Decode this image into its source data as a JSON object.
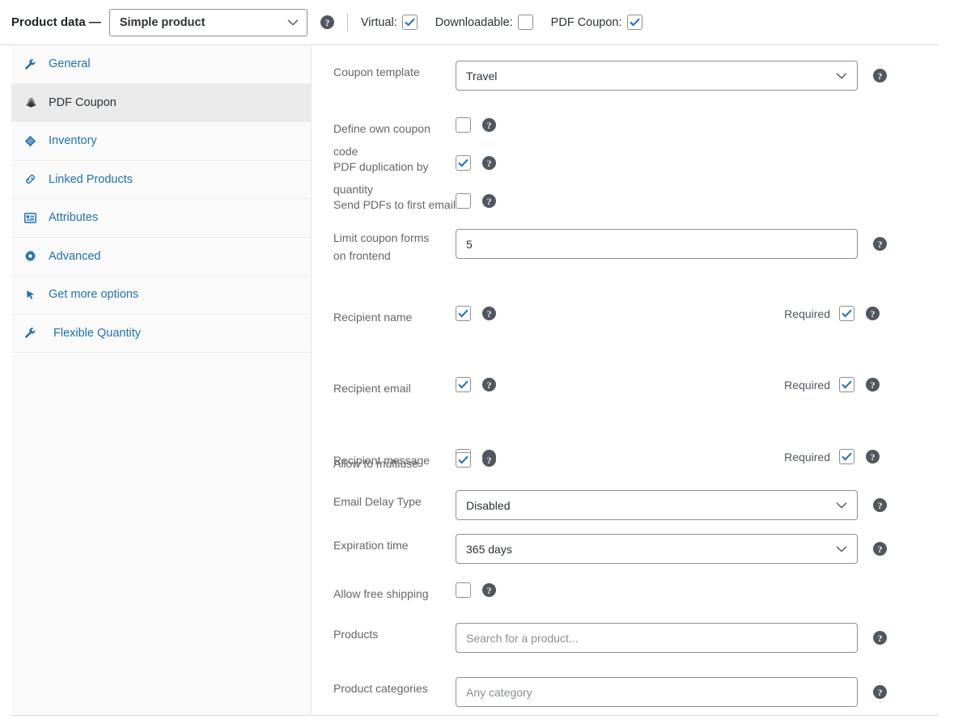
{
  "header": {
    "title": "Product data —",
    "product_type": "Simple product",
    "help_icon": "help-icon",
    "toggles": [
      {
        "label": "Virtual:",
        "checked": true,
        "name": "virtual"
      },
      {
        "label": "Downloadable:",
        "checked": false,
        "name": "downloadable"
      },
      {
        "label": "PDF Coupon:",
        "checked": true,
        "name": "pdf-coupon"
      }
    ]
  },
  "sidebar": {
    "items": [
      {
        "label": "General",
        "icon": "wrench-icon",
        "active": false
      },
      {
        "label": "PDF Coupon",
        "icon": "coupon-stack-icon",
        "active": true
      },
      {
        "label": "Inventory",
        "icon": "diamond-icon",
        "active": false
      },
      {
        "label": "Linked Products",
        "icon": "link-icon",
        "active": false
      },
      {
        "label": "Attributes",
        "icon": "list-card-icon",
        "active": false
      },
      {
        "label": "Advanced",
        "icon": "gear-icon",
        "active": false
      },
      {
        "label": "Get more options",
        "icon": "cursor-click-icon",
        "active": false
      },
      {
        "label": "Flexible Quantity",
        "icon": "wrench-icon",
        "active": false
      }
    ]
  },
  "form": {
    "coupon_template": {
      "label": "Coupon template",
      "value": "Travel"
    },
    "define_own_coupon_code": {
      "label": "Define own coupon code",
      "checked": false
    },
    "pdf_duplication": {
      "label": "PDF duplication by quantity",
      "checked": true
    },
    "send_pdfs_first_email": {
      "label": "Send PDFs to first email",
      "checked": false
    },
    "limit_coupon_forms": {
      "label_line1": "Limit coupon forms",
      "label_line2": "on frontend",
      "value": "5"
    },
    "recipient_name": {
      "label": "Recipient name",
      "checked": true,
      "required_label": "Required",
      "required_checked": true
    },
    "recipient_email": {
      "label": "Recipient email",
      "checked": true,
      "required_label": "Required",
      "required_checked": true
    },
    "recipient_message": {
      "label": "Recipient message",
      "checked": true,
      "required_label": "Required",
      "required_checked": true
    },
    "allow_multiuse": {
      "label": "Allow to multiuse",
      "checked": true
    },
    "email_delay_type": {
      "label": "Email Delay Type",
      "value": "Disabled"
    },
    "expiration_time": {
      "label": "Expiration time",
      "value": "365 days"
    },
    "allow_free_shipping": {
      "label": "Allow free shipping",
      "checked": false
    },
    "products": {
      "label": "Products",
      "placeholder": "Search for a product..."
    },
    "product_categories": {
      "label": "Product categories",
      "placeholder": "Any category"
    }
  },
  "colors": {
    "link_blue": "#2271b1",
    "check_blue": "#2271b1",
    "border_gray": "#8c8f94",
    "active_tab_bg": "#eaeaea",
    "label_gray": "#666666"
  }
}
